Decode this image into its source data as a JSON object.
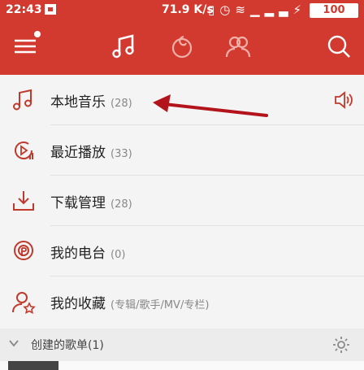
{
  "status": {
    "time": "22:43",
    "speed": "71.9 K/s",
    "battery": "100"
  },
  "tabs": [
    {
      "icon": "menu-icon"
    },
    {
      "icon": "music-note-icon"
    },
    {
      "icon": "netease-icon"
    },
    {
      "icon": "friends-icon"
    },
    {
      "icon": "search-icon"
    }
  ],
  "items": [
    {
      "label": "本地音乐",
      "count": "(28)",
      "icon": "music-note-icon"
    },
    {
      "label": "最近播放",
      "count": "(33)",
      "icon": "recent-play-icon"
    },
    {
      "label": "下载管理",
      "count": "(28)",
      "icon": "download-icon"
    },
    {
      "label": "我的电台",
      "count": "(0)",
      "icon": "radio-icon"
    },
    {
      "label": "我的收藏",
      "count": "(专辑/歌手/MV/专栏)",
      "icon": "favorite-user-icon"
    }
  ],
  "section": {
    "label": "创建的歌单(1)"
  },
  "colors": {
    "accent": "#d23a2f",
    "icon": "#c0392b"
  }
}
